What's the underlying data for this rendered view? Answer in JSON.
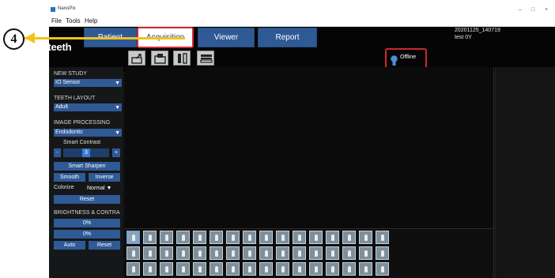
{
  "window": {
    "title": "NanoPix"
  },
  "menu": {
    "items": [
      "File",
      "Tools",
      "Help"
    ]
  },
  "logo": {
    "text": "Eighteeth"
  },
  "tabs": {
    "patient": "Patient",
    "acquisition": "Acquisition",
    "viewer": "Viewer",
    "report": "Report"
  },
  "patient_info": {
    "study_id": "20201125_140719",
    "name_age": "test 0Y"
  },
  "status": {
    "sensor": "Offline"
  },
  "left_panel": {
    "new_study_label": "NEW STUDY",
    "new_study_value": "IO Sensor",
    "teeth_layout_label": "TEETH LAYOUT",
    "teeth_layout_value": "Adult",
    "image_processing_label": "IMAGE PROCESSING",
    "image_processing_value": "Endodontic",
    "smart_contrast_label": "Smart Contrast",
    "minus": "-",
    "smart_contrast_value": "3",
    "plus": "+",
    "smart_sharpen": "Smart Sharpen",
    "smooth": "Smooth",
    "inverse": "Inverse",
    "colorize_label": "Colorize",
    "colorize_value": "Normal",
    "reset": "Reset",
    "brightness_label": "BRIGHTNESS & CONTRA",
    "brightness_value": "0%",
    "contrast_value": "0%",
    "auto": "Auto",
    "reset2": "Reset"
  },
  "callout": {
    "number": "4"
  },
  "colors": {
    "accent_blue": "#2f5a96",
    "highlight_red": "#d32a33",
    "callout_yellow": "#f2c21a"
  }
}
